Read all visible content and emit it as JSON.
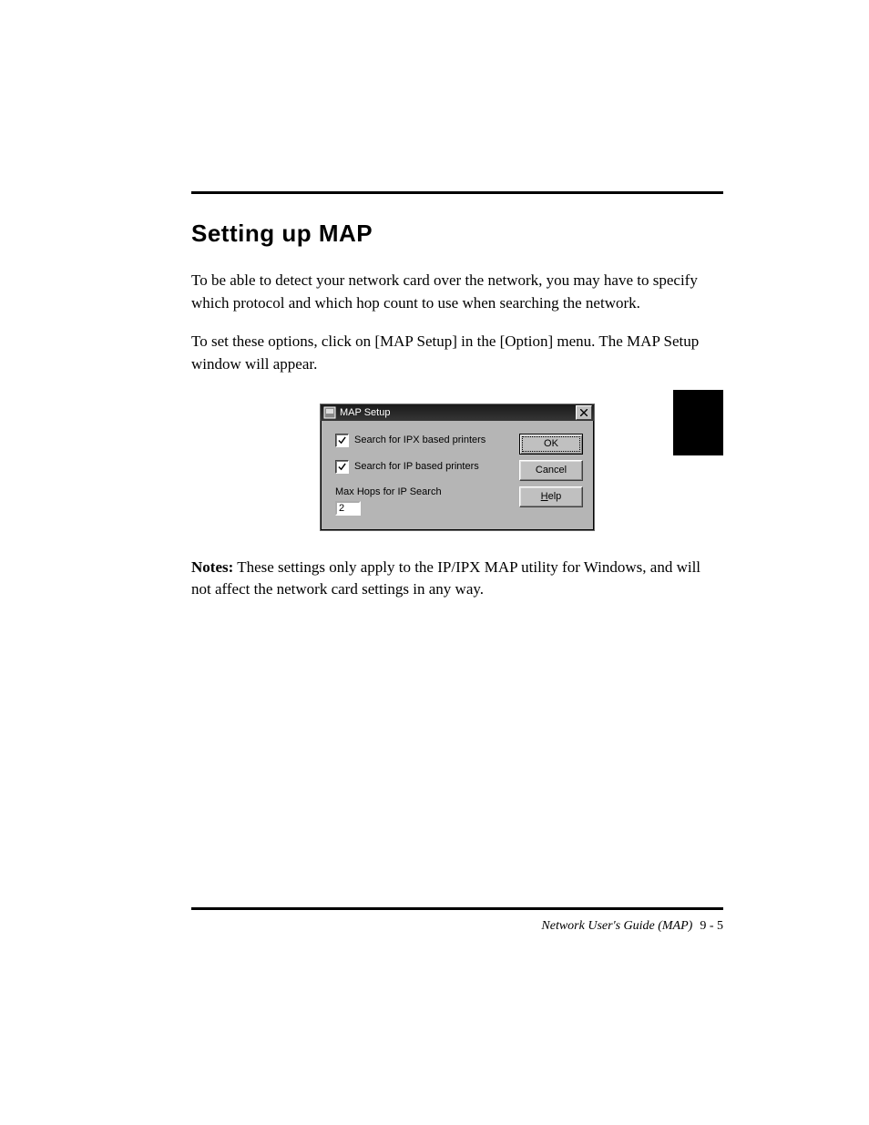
{
  "section_title": "Setting up MAP",
  "para1": "To be able to detect your network card over the network, you may have to specify which protocol and which hop count to use when searching the network.",
  "para2_a": "To set these options, click on [MAP Setup] in the [Option] menu. ",
  "para2_b": "The MAP Setup window will appear.",
  "dialog": {
    "title": "MAP Setup",
    "chk_ipx": "Search for IPX based printers",
    "chk_ip": "Search for IP based printers",
    "hops_label": "Max Hops for IP Search",
    "hops_value": "2",
    "ok": "OK",
    "cancel": "Cancel",
    "help_prefix": "H",
    "help_rest": "elp"
  },
  "note_label": "Notes:",
  "note_body": " These settings only apply to the IP/IPX MAP utility for Windows, and will not affect the network card settings in any way.",
  "footer_text": "Network User's Guide (MAP)",
  "footer_page": "9 - 5"
}
